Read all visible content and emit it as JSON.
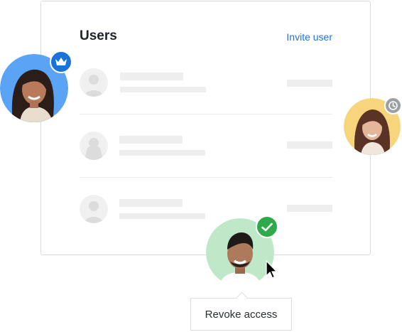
{
  "panel": {
    "title": "Users",
    "invite_label": "Invite user"
  },
  "rows": [
    {
      "name_placeholder": "",
      "detail_placeholder": ""
    },
    {
      "name_placeholder": "",
      "detail_placeholder": ""
    },
    {
      "name_placeholder": "",
      "detail_placeholder": ""
    }
  ],
  "avatars": {
    "owner": {
      "badge_icon": "crown-icon",
      "ring_color": "#5ba3f5",
      "badge_color": "#1a73d9"
    },
    "pending": {
      "badge_icon": "clock-icon",
      "ring_color": "#f7d57c",
      "badge_color": "#9aa0a6"
    },
    "active": {
      "badge_icon": "check-icon",
      "ring_color": "#bfe8c8",
      "badge_color": "#2eaa4a"
    }
  },
  "tooltip": {
    "label": "Revoke access"
  },
  "colors": {
    "accent": "#1a73d9",
    "success": "#2eaa4a",
    "skeleton": "#eeeeee"
  }
}
